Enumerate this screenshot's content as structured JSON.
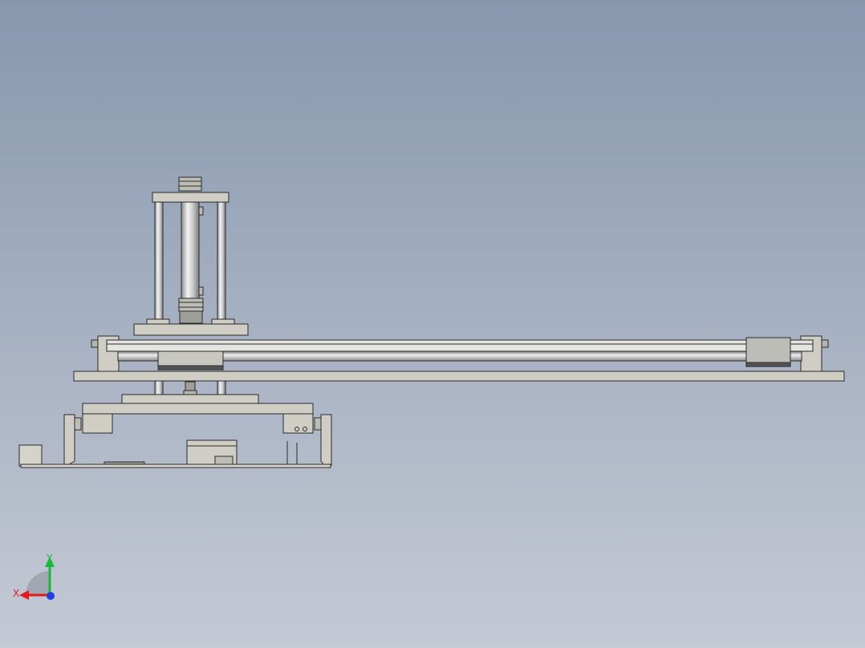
{
  "viewport": {
    "background_top": "#8797ad",
    "background_bottom": "#c4c9d4",
    "model_fill": "#cfcdc4",
    "model_edge": "#2a2a2a",
    "rod_fill": "#d8d8d8"
  },
  "triad": {
    "x_label": "X",
    "y_label": "Y",
    "x_color": "#e01b1b",
    "y_color": "#19b73a",
    "z_color": "#1f3fe0"
  }
}
